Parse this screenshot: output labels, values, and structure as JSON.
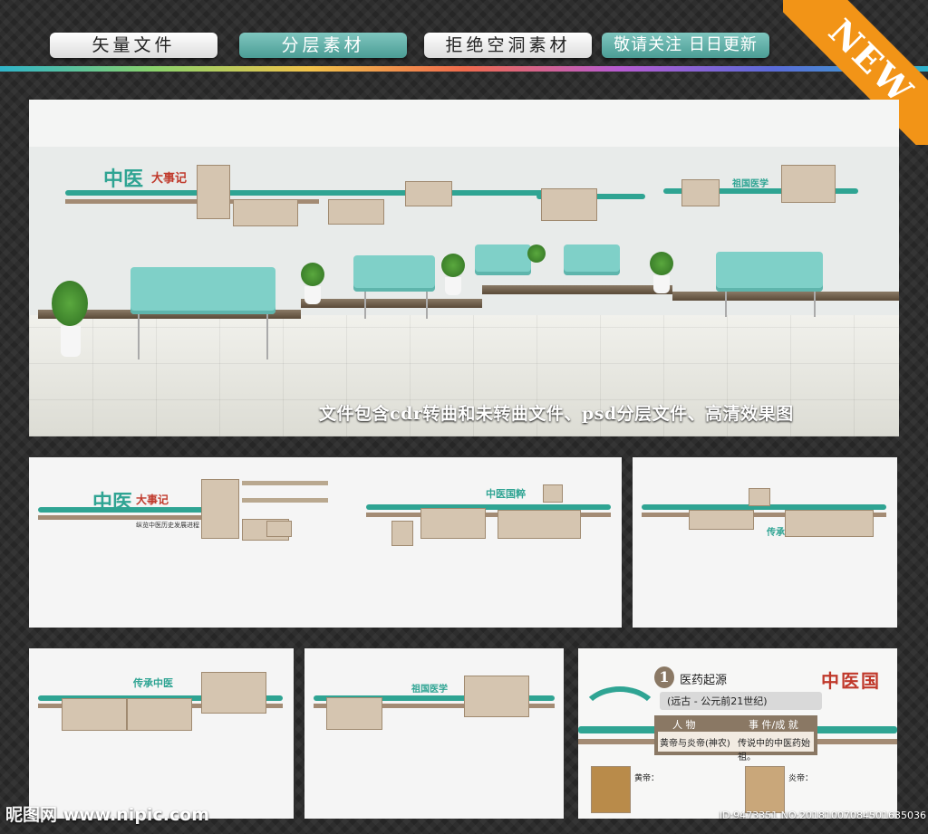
{
  "tags": [
    "矢量文件",
    "分层素材",
    "拒绝空洞素材",
    "敬请关注 日日更新"
  ],
  "badge": "NEW",
  "caption": "文件包含cdr转曲和未转曲文件、psd分层文件、高清效果图",
  "scene_text": {
    "zhongyi": "中医",
    "dashiji": "大事记",
    "subtitle": "纵览中医历史发展进程",
    "zuguo": "祖国医学",
    "chuancheng": "传承中医",
    "guocui": "中医国粹"
  },
  "detail": {
    "number": "1",
    "title": "医药起源",
    "period": "(远古 - 公元前21世纪)",
    "col1": "人 物",
    "col2": "事 件/成 就",
    "person": "黄帝与炎帝(神农)",
    "event": "传说中的中医药始祖。",
    "zhongyi_guo": "中医国",
    "name_huangdi": "黄帝：",
    "name_yandi": "炎帝："
  },
  "watermark": "昵图网 www.nipic.com",
  "image_id": "ID:9473351 NO:20181007084501635036",
  "colors": {
    "teal": "#2fa493",
    "accent": "#f29417",
    "bench": "#7fd0c8"
  }
}
